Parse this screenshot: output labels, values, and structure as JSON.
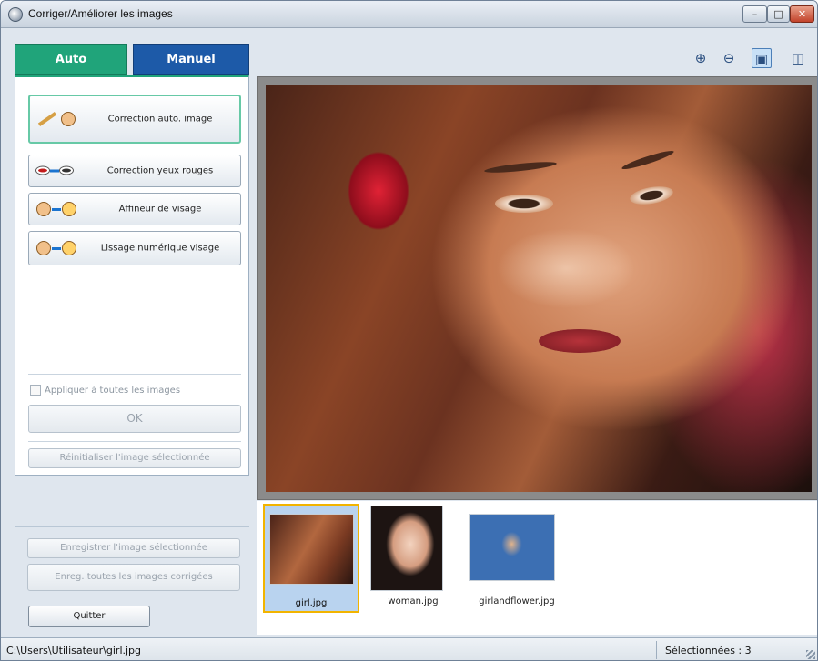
{
  "window": {
    "title": "Corriger/Améliorer les images",
    "controls": {
      "minimize": "–",
      "maximize": "□",
      "close": "✕"
    }
  },
  "tabs": [
    {
      "label": "Auto",
      "active": true
    },
    {
      "label": "Manuel",
      "active": false
    }
  ],
  "functions": [
    {
      "label": "Correction auto. image",
      "icon": "auto-correct-icon",
      "selected": true
    },
    {
      "label": "Correction yeux rouges",
      "icon": "red-eye-icon",
      "selected": false
    },
    {
      "label": "Affineur de visage",
      "icon": "face-sharpener-icon",
      "selected": false
    },
    {
      "label": "Lissage numérique visage",
      "icon": "face-smoothing-icon",
      "selected": false
    }
  ],
  "apply_all": {
    "label": "Appliquer à toutes les images",
    "checked": false
  },
  "buttons": {
    "ok": "OK",
    "reset": "Réinitialiser l'image sélectionnée",
    "save_selected": "Enregistrer l'image sélectionnée",
    "save_all": "Enreg. toutes les images corrigées",
    "quit": "Quitter"
  },
  "toolbar": {
    "zoom_in": "⊕",
    "zoom_out": "⊖",
    "view_whole": "▣",
    "compare": "◫"
  },
  "thumbnails": [
    {
      "name": "girl.jpg",
      "selected": true
    },
    {
      "name": "woman.jpg",
      "selected": false
    },
    {
      "name": "girlandflower.jpg",
      "selected": false
    }
  ],
  "status": {
    "path": "C:\\Users\\Utilisateur\\girl.jpg",
    "selected_count": "Sélectionnées : 3"
  },
  "colors": {
    "auto_tab": "#20a47a",
    "manuel_tab": "#1d5aa8",
    "selection": "#f2b400"
  }
}
